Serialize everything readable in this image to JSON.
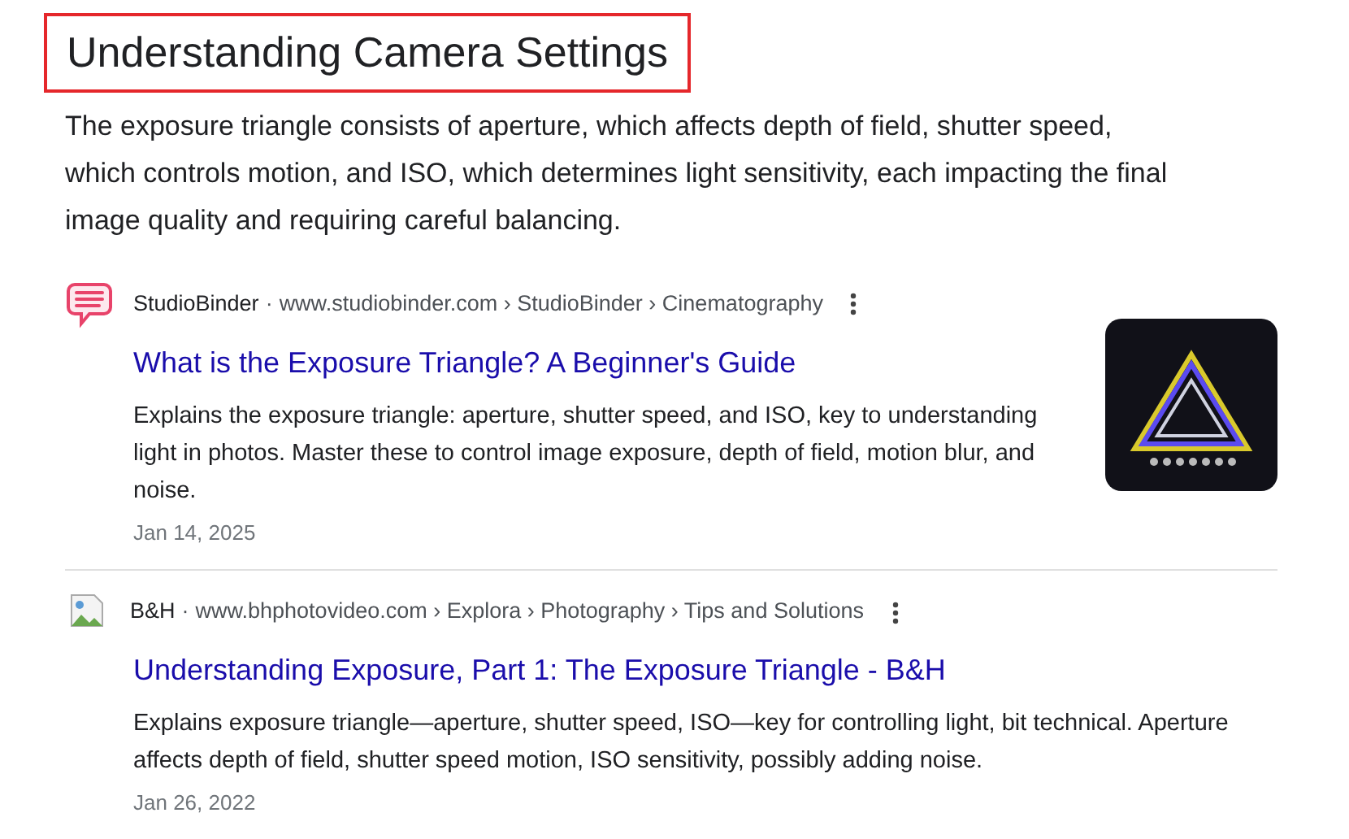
{
  "heading": "Understanding Camera Settings",
  "summary": "The exposure triangle consists of aperture, which affects depth of field, shutter speed, which controls motion, and ISO, which determines light sensitivity, each impacting the final image quality and requiring careful balancing.",
  "results": [
    {
      "kind": "thumbnail",
      "source": "StudioBinder",
      "separator": "·",
      "url": "www.studiobinder.com › StudioBinder › Cinematography",
      "title": "What is the Exposure Triangle? A Beginner's Guide",
      "snippet": "Explains the exposure triangle: aperture, shutter speed, and ISO, key to understanding light in photos. Master these to control image exposure, depth of field, motion blur, and noise.",
      "date": "Jan 14, 2025"
    },
    {
      "kind": "plain",
      "source": "B&H",
      "separator": "·",
      "url": "www.bhphotovideo.com › Explora › Photography › Tips and Solutions",
      "title": "Understanding Exposure, Part 1: The Exposure Triangle - B&H",
      "snippet": "Explains exposure triangle—aperture, shutter speed, ISO—key for controlling light, bit technical. Aperture affects depth of field, shutter speed motion, ISO sensitivity, possibly adding noise.",
      "date": "Jan 26, 2022"
    }
  ]
}
